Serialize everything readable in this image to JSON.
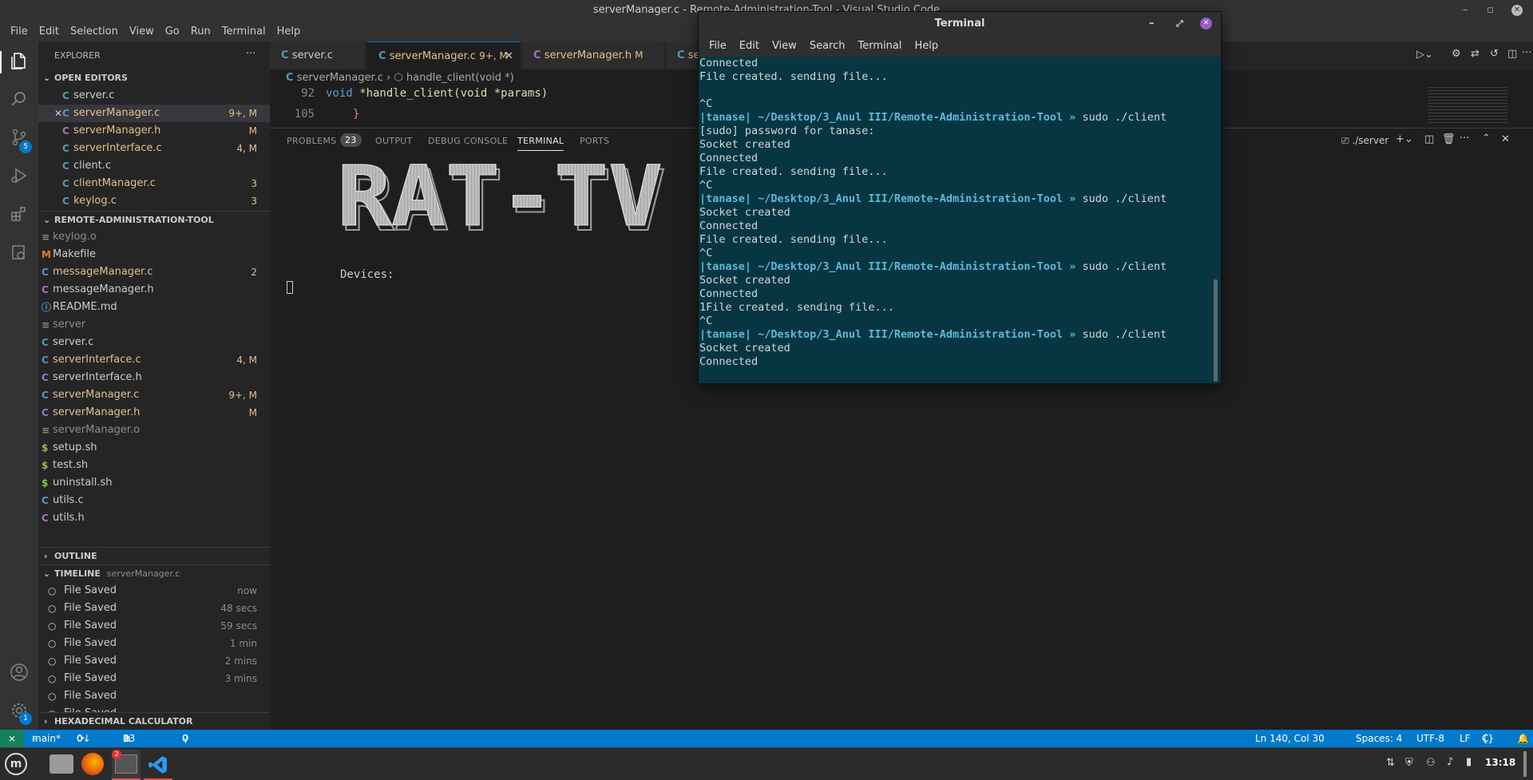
{
  "window": {
    "title": "serverManager.c - Remote-Administration-Tool - Visual Studio Code"
  },
  "menu": [
    "File",
    "Edit",
    "Selection",
    "View",
    "Go",
    "Run",
    "Terminal",
    "Help"
  ],
  "activity": {
    "scm_badge": "5",
    "settings_badge": "1"
  },
  "explorer": {
    "header": "EXPLORER",
    "open_editors_header": "OPEN EDITORS",
    "open_editors": [
      {
        "name": "server.c",
        "status": "",
        "icon": "C",
        "color": "#cccccc",
        "icon_color": "#519aba"
      },
      {
        "name": "serverManager.c",
        "status": "9+, M",
        "icon": "C",
        "color": "#e2c08d",
        "icon_color": "#519aba",
        "close": "✕"
      },
      {
        "name": "serverManager.h",
        "status": "M",
        "icon": "C",
        "color": "#e2c08d",
        "icon_color": "#a074c4"
      },
      {
        "name": "serverInterface.c",
        "status": "4, M",
        "icon": "C",
        "color": "#e2c08d",
        "icon_color": "#519aba"
      },
      {
        "name": "client.c",
        "status": "",
        "icon": "C",
        "color": "#cccccc",
        "icon_color": "#519aba"
      },
      {
        "name": "clientManager.c",
        "status": "3",
        "icon": "C",
        "color": "#e2c08d",
        "icon_color": "#519aba"
      },
      {
        "name": "keylog.c",
        "status": "3",
        "icon": "C",
        "color": "#e2c08d",
        "icon_color": "#519aba"
      }
    ],
    "folder_header": "REMOTE-ADMINISTRATION-TOOL",
    "files": [
      {
        "name": "keylog.o",
        "status": "",
        "icon": "≡",
        "color": "#8c8c8c",
        "icon_color": "#8c8c8c"
      },
      {
        "name": "Makefile",
        "status": "",
        "icon": "M",
        "color": "#cccccc",
        "icon_color": "#e37933"
      },
      {
        "name": "messageManager.c",
        "status": "2",
        "icon": "C",
        "color": "#e2c08d",
        "icon_color": "#519aba"
      },
      {
        "name": "messageManager.h",
        "status": "",
        "icon": "C",
        "color": "#cccccc",
        "icon_color": "#a074c4"
      },
      {
        "name": "README.md",
        "status": "",
        "icon": "ⓘ",
        "color": "#cccccc",
        "icon_color": "#519aba"
      },
      {
        "name": "server",
        "status": "",
        "icon": "≡",
        "color": "#8c8c8c",
        "icon_color": "#8c8c8c"
      },
      {
        "name": "server.c",
        "status": "",
        "icon": "C",
        "color": "#cccccc",
        "icon_color": "#519aba"
      },
      {
        "name": "serverInterface.c",
        "status": "4, M",
        "icon": "C",
        "color": "#e2c08d",
        "icon_color": "#519aba"
      },
      {
        "name": "serverInterface.h",
        "status": "",
        "icon": "C",
        "color": "#cccccc",
        "icon_color": "#a074c4"
      },
      {
        "name": "serverManager.c",
        "status": "9+, M",
        "icon": "C",
        "color": "#e2c08d",
        "icon_color": "#519aba"
      },
      {
        "name": "serverManager.h",
        "status": "M",
        "icon": "C",
        "color": "#e2c08d",
        "icon_color": "#a074c4"
      },
      {
        "name": "serverManager.o",
        "status": "",
        "icon": "≡",
        "color": "#8c8c8c",
        "icon_color": "#8c8c8c"
      },
      {
        "name": "setup.sh",
        "status": "",
        "icon": "$",
        "color": "#cccccc",
        "icon_color": "#8dc149"
      },
      {
        "name": "test.sh",
        "status": "",
        "icon": "$",
        "color": "#cccccc",
        "icon_color": "#8dc149"
      },
      {
        "name": "uninstall.sh",
        "status": "",
        "icon": "$",
        "color": "#cccccc",
        "icon_color": "#8dc149"
      },
      {
        "name": "utils.c",
        "status": "",
        "icon": "C",
        "color": "#cccccc",
        "icon_color": "#519aba"
      },
      {
        "name": "utils.h",
        "status": "",
        "icon": "C",
        "color": "#cccccc",
        "icon_color": "#a074c4"
      }
    ],
    "outline_header": "OUTLINE",
    "timeline_header": "TIMELINE",
    "timeline_file": "serverManager.c",
    "timeline": [
      {
        "label": "File Saved",
        "time": "now"
      },
      {
        "label": "File Saved",
        "time": "48 secs"
      },
      {
        "label": "File Saved",
        "time": "59 secs"
      },
      {
        "label": "File Saved",
        "time": "1 min"
      },
      {
        "label": "File Saved",
        "time": "2 mins"
      },
      {
        "label": "File Saved",
        "time": "3 mins"
      },
      {
        "label": "File Saved",
        "time": ""
      },
      {
        "label": "File Saved",
        "time": ""
      }
    ],
    "hex_header": "HEXADECIMAL CALCULATOR"
  },
  "tabs": [
    {
      "label": "server.c",
      "badge": ""
    },
    {
      "label": "serverManager.c",
      "badge": "9+, M"
    },
    {
      "label": "serverManager.h",
      "badge": "M"
    },
    {
      "label": "se",
      "badge": ""
    }
  ],
  "breadcrumb": {
    "file": "serverManager.c",
    "symbol": "handle_client(void *)"
  },
  "code": {
    "line1_no": "92",
    "line1_kw": "void",
    "line1_rest": " *handle_client(void *params)",
    "line2_no": "105",
    "line2_text": "}"
  },
  "panel": {
    "problems": "PROBLEMS",
    "problems_count": "23",
    "output": "OUTPUT",
    "debug": "DEBUG CONSOLE",
    "terminal": "TERMINAL",
    "ports": "PORTS",
    "shell": "./server"
  },
  "term": {
    "banner": "RAT-TV",
    "devices": "Devices:"
  },
  "floating_terminal": {
    "title": "Terminal",
    "menu": [
      "File",
      "Edit",
      "View",
      "Search",
      "Terminal",
      "Help"
    ],
    "prompt": "|tanase| ~/Desktop/3_Anul III/Remote-Administration-Tool »",
    "lines": [
      {
        "t": "Connected"
      },
      {
        "t": "File created. sending file..."
      },
      {
        "t": ""
      },
      {
        "t": "^C"
      },
      {
        "p": true,
        "t": " sudo ./client"
      },
      {
        "t": "[sudo] password for tanase:"
      },
      {
        "t": "Socket created"
      },
      {
        "t": "Connected"
      },
      {
        "t": "File created. sending file..."
      },
      {
        "t": "^C"
      },
      {
        "p": true,
        "t": " sudo ./client"
      },
      {
        "t": "Socket created"
      },
      {
        "t": "Connected"
      },
      {
        "t": "File created. sending file..."
      },
      {
        "t": "^C"
      },
      {
        "p": true,
        "t": " sudo ./client"
      },
      {
        "t": "Socket created"
      },
      {
        "t": "Connected"
      },
      {
        "t": "1File created. sending file..."
      },
      {
        "t": "^C"
      },
      {
        "p": true,
        "t": " sudo ./client"
      },
      {
        "t": "Socket created"
      },
      {
        "t": "Connected"
      }
    ]
  },
  "status": {
    "branch": "main*",
    "sync": "0↓ 2↑",
    "errors": "0",
    "warnings": "23",
    "ports": "0",
    "position": "Ln 140, Col 30",
    "spaces": "Spaces: 4",
    "encoding": "UTF-8",
    "eol": "LF",
    "language": "C",
    "os": "Linux"
  },
  "taskbar": {
    "clock": "13:18",
    "term_badge": "2"
  }
}
